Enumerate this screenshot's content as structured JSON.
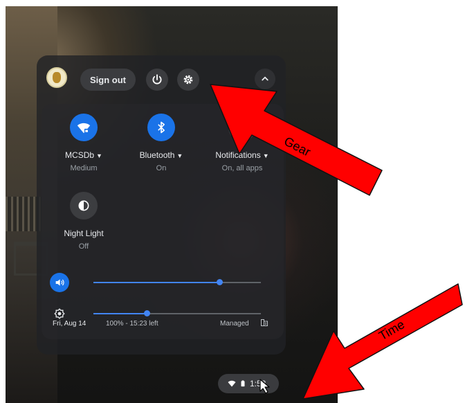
{
  "colors": {
    "accent": "#1a73e8",
    "slider": "#4285f4",
    "arrow": "#ff0000"
  },
  "header": {
    "sign_out": "Sign out",
    "power_icon": "power-icon",
    "gear_icon": "gear-icon",
    "collapse_icon": "chevron-icon"
  },
  "tiles": [
    {
      "label": "MCSDb",
      "sub": "Medium",
      "icon": "wifi-icon",
      "active": true,
      "dropdown": true
    },
    {
      "label": "Bluetooth",
      "sub": "On",
      "icon": "bluetooth-icon",
      "active": true,
      "dropdown": true
    },
    {
      "label": "Notifications",
      "sub": "On, all apps",
      "icon": "notifications-icon",
      "active": false,
      "dropdown": true
    },
    {
      "label": "Night Light",
      "sub": "Off",
      "icon": "night-light-icon",
      "active": false,
      "dropdown": false
    }
  ],
  "sliders": {
    "volume": {
      "icon": "volume-icon",
      "level": 0.75
    },
    "brightness": {
      "icon": "brightness-icon",
      "level": 0.32
    }
  },
  "footer": {
    "date": "Fri, Aug 14",
    "battery": "100% - 15:23 left",
    "managed": "Managed"
  },
  "tray": {
    "time": "1:52"
  },
  "annotations": {
    "gear": "Gear",
    "time": "Time"
  }
}
